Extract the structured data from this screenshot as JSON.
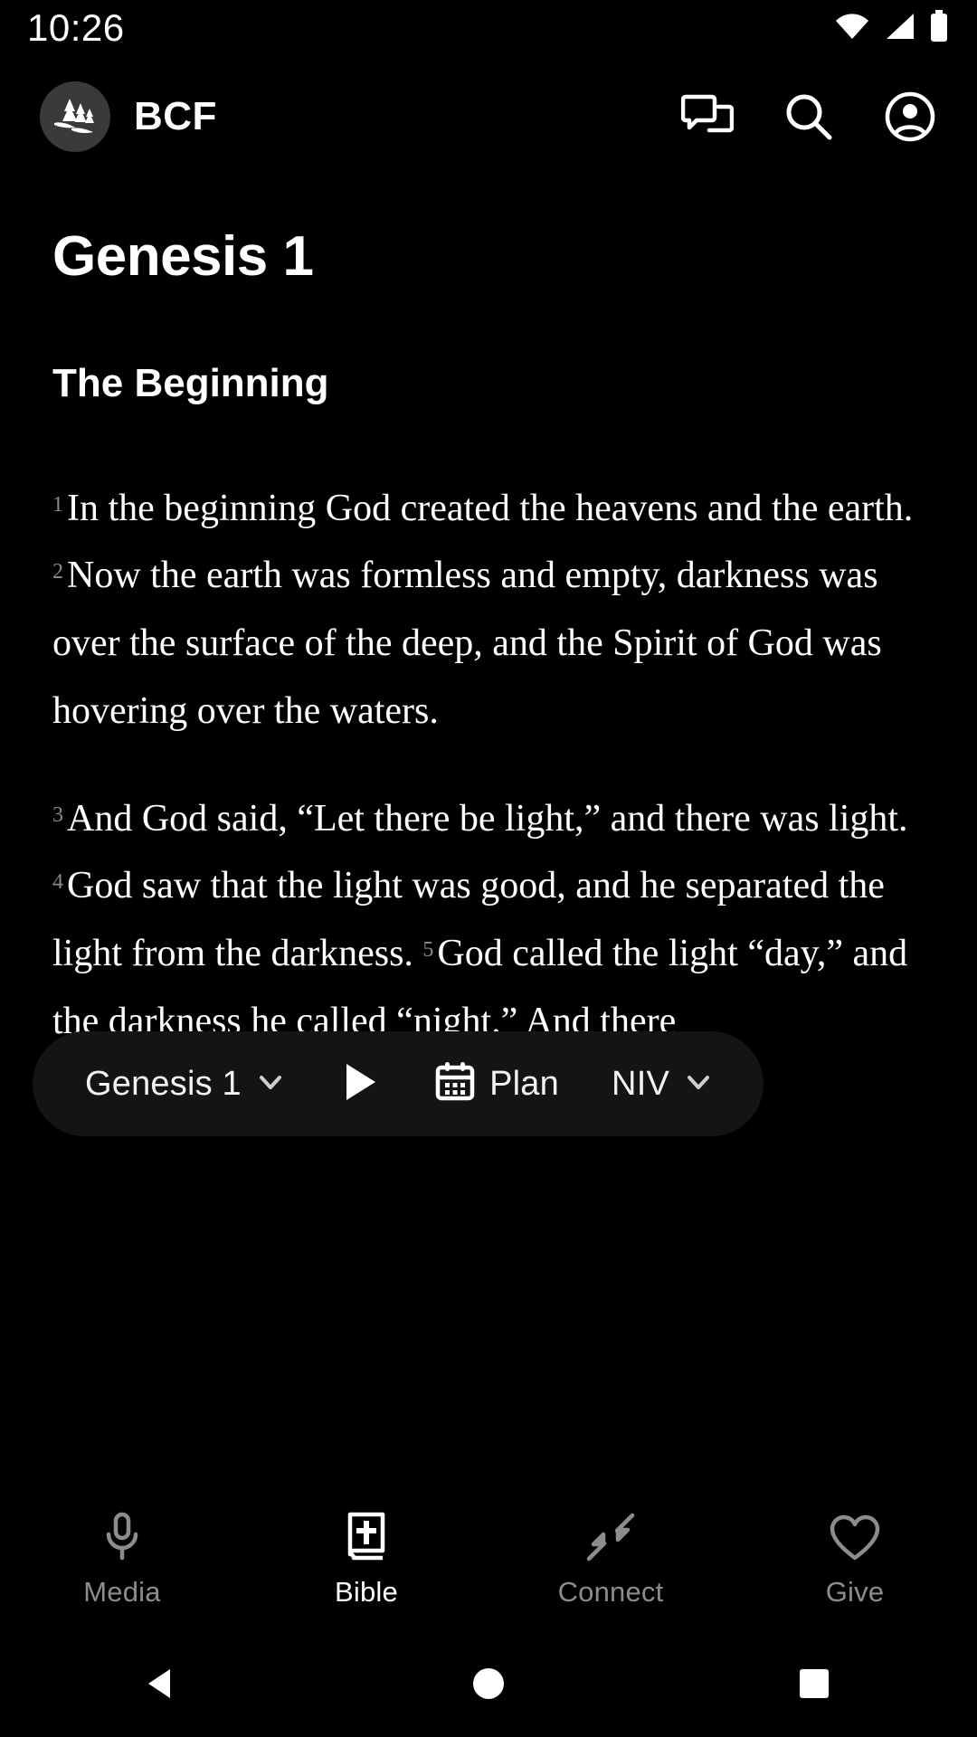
{
  "status_bar": {
    "time": "10:26",
    "icons": [
      "wifi-icon",
      "cellular-signal-icon",
      "battery-full-icon"
    ]
  },
  "header": {
    "logo_icon": "pine-trees-logo",
    "brand": "BCF",
    "actions": [
      {
        "name": "chat-bubbles-icon",
        "label": "Messages"
      },
      {
        "name": "search-icon",
        "label": "Search"
      },
      {
        "name": "account-circle-icon",
        "label": "Account"
      }
    ]
  },
  "content": {
    "chapter_title": "Genesis 1",
    "section_heading": "The Beginning",
    "paragraphs": [
      {
        "segments": [
          {
            "verse": "1",
            "text": "In the beginning God created the heavens and the earth."
          },
          {
            "verse": "2",
            "text": "Now the earth was formless and empty, darkness was over the surface of the deep, and the Spirit of God was hovering over the waters."
          }
        ]
      },
      {
        "segments": [
          {
            "verse": "3",
            "text": "And God said, “Let there be light,” and there was light."
          },
          {
            "verse": "4",
            "text": "God saw that the light was good, and he separated the light from the darkness."
          },
          {
            "verse": "5",
            "text": "God called the light “day,” and the darkness he called “night.” And there"
          }
        ]
      }
    ]
  },
  "pill_bar": {
    "chapter_selector": {
      "label": "Genesis 1",
      "chevron": "chevron-down-icon"
    },
    "play": {
      "icon": "play-icon"
    },
    "plan": {
      "icon": "calendar-icon",
      "label": "Plan"
    },
    "version_selector": {
      "label": "NIV",
      "chevron": "chevron-down-icon"
    }
  },
  "bottom_nav": {
    "active": "Bible",
    "items": [
      {
        "label": "Media",
        "icon": "microphone-icon",
        "active": false
      },
      {
        "label": "Bible",
        "icon": "bible-book-cross-icon",
        "active": true
      },
      {
        "label": "Connect",
        "icon": "collapse-arrows-icon",
        "active": false
      },
      {
        "label": "Give",
        "icon": "heart-outline-icon",
        "active": false
      }
    ]
  },
  "system_nav": {
    "buttons": [
      {
        "name": "back-button",
        "icon": "triangle-left-icon"
      },
      {
        "name": "home-button",
        "icon": "circle-icon"
      },
      {
        "name": "recents-button",
        "icon": "square-icon"
      }
    ]
  },
  "colors": {
    "background": "#000000",
    "pill_background": "#141414",
    "logo_background": "#3a3a3a",
    "inactive_text": "#8c8c8c",
    "verse_number": "#8a8a8a"
  }
}
